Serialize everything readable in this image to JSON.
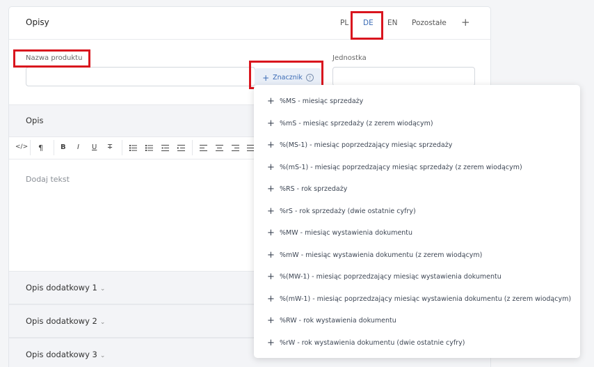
{
  "card": {
    "title": "Opisy",
    "lang_tabs": [
      "PL",
      "DE",
      "EN",
      "Pozostałe"
    ],
    "add_tab": "+"
  },
  "fields": {
    "product_name_label": "Nazwa produktu",
    "unit_label": "Jednostka",
    "tag_button_label": "Znacznik",
    "tag_button_plus": "+",
    "tag_help": "?"
  },
  "sections": {
    "description": "Opis",
    "placeholder": "Dodaj tekst",
    "extra_1": "Opis dodatkowy 1",
    "extra_2": "Opis dodatkowy 2",
    "extra_3": "Opis dodatkowy 3",
    "chevron": "⌄"
  },
  "toolbar": {
    "code": "</>",
    "paragraph": "¶",
    "bold": "B",
    "italic": "I",
    "underline": "U",
    "strike": "T"
  },
  "dropdown": {
    "plus": "+",
    "items": [
      "%MS - miesiąc sprzedaży",
      "%mS - miesiąc sprzedaży (z zerem wiodącym)",
      "%(MS-1) - miesiąc poprzedzający miesiąc sprzedaży",
      "%(mS-1) - miesiąc poprzedzający miesiąc sprzedaży (z zerem wiodącym)",
      "%RS - rok sprzedaży",
      "%rS - rok sprzedaży (dwie ostatnie cyfry)",
      "%MW - miesiąc wystawienia dokumentu",
      "%mW - miesiąc wystawienia dokumentu (z zerem wiodącym)",
      "%(MW-1) - miesiąc poprzedzający miesiąc wystawienia dokumentu",
      "%(mW-1) - miesiąc poprzedzający miesiąc wystawienia dokumentu (z zerem wiodącym)",
      "%RW - rok wystawienia dokumentu",
      "%rW - rok wystawienia dokumentu (dwie ostatnie cyfry)"
    ]
  },
  "colors": {
    "accent": "#3a6bb5",
    "highlight": "#d9151e"
  }
}
